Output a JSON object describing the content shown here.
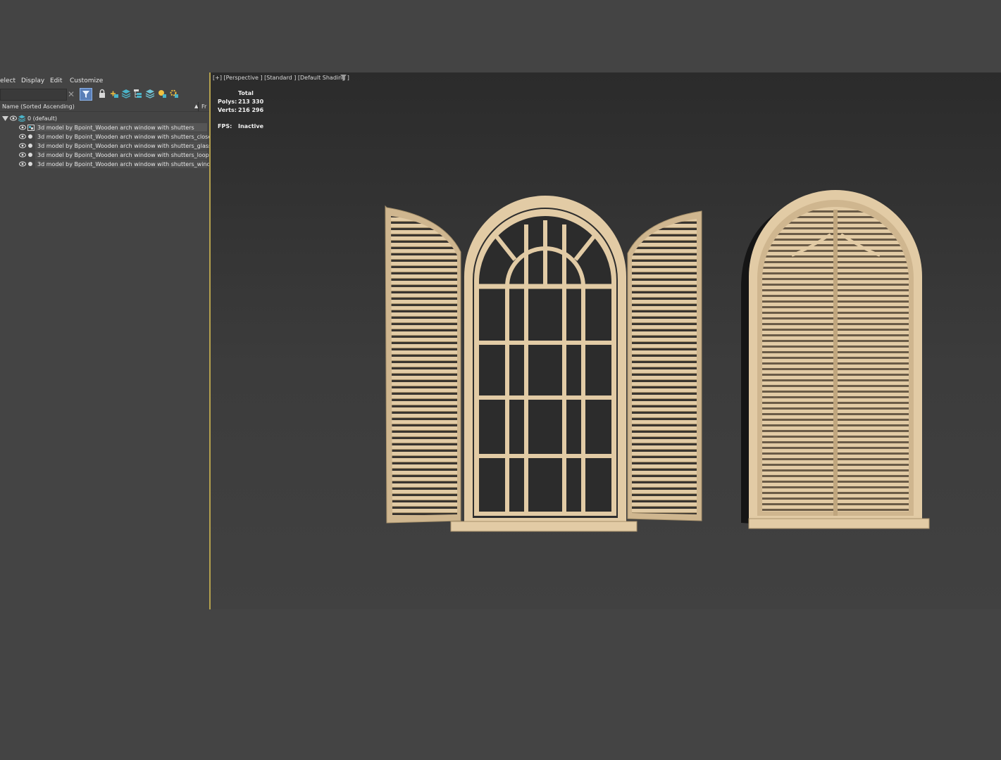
{
  "menu": {
    "select": "elect",
    "display": "Display",
    "edit": "Edit",
    "customize": "Customize"
  },
  "explorer": {
    "column_name": "Name (Sorted Ascending)",
    "column_frozen": "Fr",
    "sort_indicator": "▲",
    "layer_label": "0 (default)",
    "objects": [
      "3d model by Bpoint_Wooden arch window with shutters",
      "3d model by Bpoint_Wooden arch window with shutters_closed",
      "3d model by Bpoint_Wooden arch window with shutters_glass",
      "3d model by Bpoint_Wooden arch window with shutters_loops",
      "3d model by Bpoint_Wooden arch window with shutters_window"
    ]
  },
  "viewport": {
    "label": "[+] [Perspective ] [Standard ] [Default Shading ]",
    "stats": {
      "total_label": "Total",
      "polys_label": "Polys:",
      "polys_value": "213 330",
      "verts_label": "Verts:",
      "verts_value": "216 296",
      "fps_label": "FPS:",
      "fps_value": "Inactive"
    }
  },
  "colors": {
    "wood": "#e2cba5",
    "wood_dark": "#a8926c",
    "accent_divider": "#b5a14e",
    "filter_active": "#5a7fb8"
  }
}
